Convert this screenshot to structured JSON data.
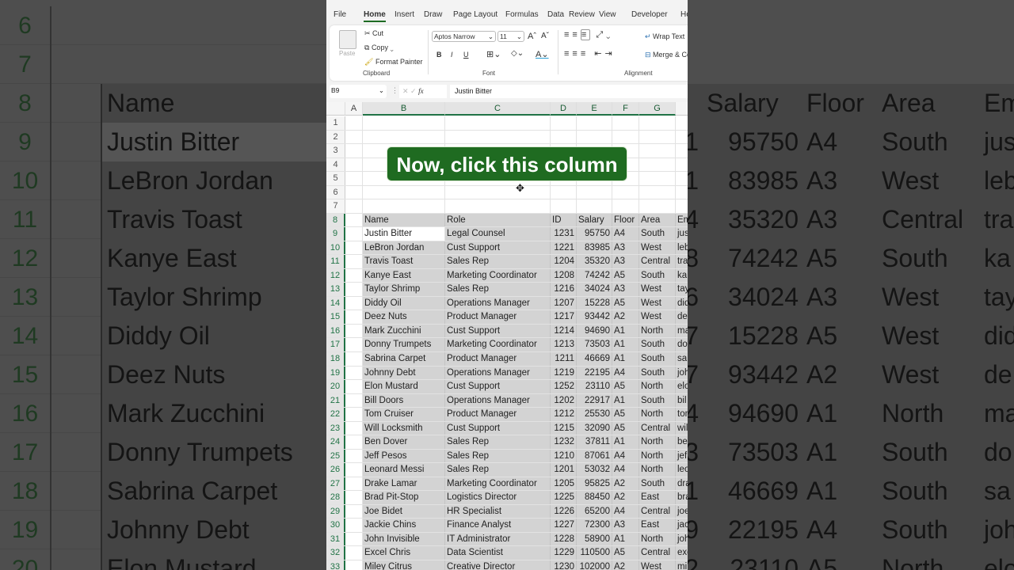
{
  "ribbon": {
    "tabs": [
      "File",
      "Home",
      "Insert",
      "Draw",
      "Page Layout",
      "Formulas",
      "Data",
      "Review",
      "View",
      "Developer",
      "He"
    ],
    "active_tab": "Home",
    "clipboard": {
      "paste": "Paste",
      "cut": "Cut",
      "copy": "Copy",
      "format_painter": "Format Painter",
      "group": "Clipboard"
    },
    "font": {
      "name": "Aptos Narrow",
      "size": "11",
      "bold": "B",
      "italic": "I",
      "underline": "U",
      "group": "Font"
    },
    "alignment": {
      "wrap_text": "Wrap Text",
      "merge": "Merge & Ce",
      "group": "Alignment"
    }
  },
  "formula_bar": {
    "name_box": "B9",
    "fx": "fx",
    "value": "Justin Bitter"
  },
  "columns": [
    "A",
    "B",
    "C",
    "D",
    "E",
    "F",
    "G"
  ],
  "callout": "Now, click this column",
  "table": {
    "headers": [
      "Name",
      "Role",
      "ID",
      "Salary",
      "Floor",
      "Area",
      "Em"
    ],
    "rows": [
      [
        "Justin Bitter",
        "Legal Counsel",
        "1231",
        "95750",
        "A4",
        "South",
        "jus"
      ],
      [
        "LeBron Jordan",
        "Cust Support",
        "1221",
        "83985",
        "A3",
        "West",
        "leb"
      ],
      [
        "Travis Toast",
        "Sales Rep",
        "1204",
        "35320",
        "A3",
        "Central",
        "tra"
      ],
      [
        "Kanye East",
        "Marketing Coordinator",
        "1208",
        "74242",
        "A5",
        "South",
        "ka"
      ],
      [
        "Taylor Shrimp",
        "Sales Rep",
        "1216",
        "34024",
        "A3",
        "West",
        "tay"
      ],
      [
        "Diddy Oil",
        "Operations Manager",
        "1207",
        "15228",
        "A5",
        "West",
        "did"
      ],
      [
        "Deez Nuts",
        "Product Manager",
        "1217",
        "93442",
        "A2",
        "West",
        "de"
      ],
      [
        "Mark Zucchini",
        "Cust Support",
        "1214",
        "94690",
        "A1",
        "North",
        "ma"
      ],
      [
        "Donny Trumpets",
        "Marketing Coordinator",
        "1213",
        "73503",
        "A1",
        "South",
        "do"
      ],
      [
        "Sabrina Carpet",
        "Product Manager",
        "1211",
        "46669",
        "A1",
        "South",
        "sa"
      ],
      [
        "Johnny Debt",
        "Operations Manager",
        "1219",
        "22195",
        "A4",
        "South",
        "joh"
      ],
      [
        "Elon Mustard",
        "Cust Support",
        "1252",
        "23110",
        "A5",
        "North",
        "elo"
      ],
      [
        "Bill Doors",
        "Operations Manager",
        "1202",
        "22917",
        "A1",
        "South",
        "bil"
      ],
      [
        "Tom Cruiser",
        "Product Manager",
        "1212",
        "25530",
        "A5",
        "North",
        "tom"
      ],
      [
        "Will Locksmith",
        "Cust Support",
        "1215",
        "32090",
        "A5",
        "Central",
        "wil"
      ],
      [
        "Ben Dover",
        "Sales Rep",
        "1232",
        "37811",
        "A1",
        "North",
        "be"
      ],
      [
        "Jeff Pesos",
        "Sales Rep",
        "1210",
        "87061",
        "A4",
        "North",
        "jef"
      ],
      [
        "Leonard Messi",
        "Sales Rep",
        "1201",
        "53032",
        "A4",
        "North",
        "leo"
      ],
      [
        "Drake Lamar",
        "Marketing Coordinator",
        "1205",
        "95825",
        "A2",
        "South",
        "dra"
      ],
      [
        "Brad Pit-Stop",
        "Logistics Director",
        "1225",
        "88450",
        "A2",
        "East",
        "bra"
      ],
      [
        "Joe Bidet",
        "HR Specialist",
        "1226",
        "65200",
        "A4",
        "Central",
        "joe"
      ],
      [
        "Jackie Chins",
        "Finance Analyst",
        "1227",
        "72300",
        "A3",
        "East",
        "jac"
      ],
      [
        "John Invisible",
        "IT Administrator",
        "1228",
        "58900",
        "A1",
        "North",
        "joh"
      ],
      [
        "Excel Chris",
        "Data Scientist",
        "1229",
        "110500",
        "A5",
        "Central",
        "exc"
      ],
      [
        "Miley Citrus",
        "Creative Director",
        "1230",
        "102000",
        "A2",
        "West",
        "mi"
      ]
    ]
  },
  "colors": {
    "accent": "#217346",
    "callout_bg": "#1f6b21",
    "selection": "#d3d3d3"
  }
}
